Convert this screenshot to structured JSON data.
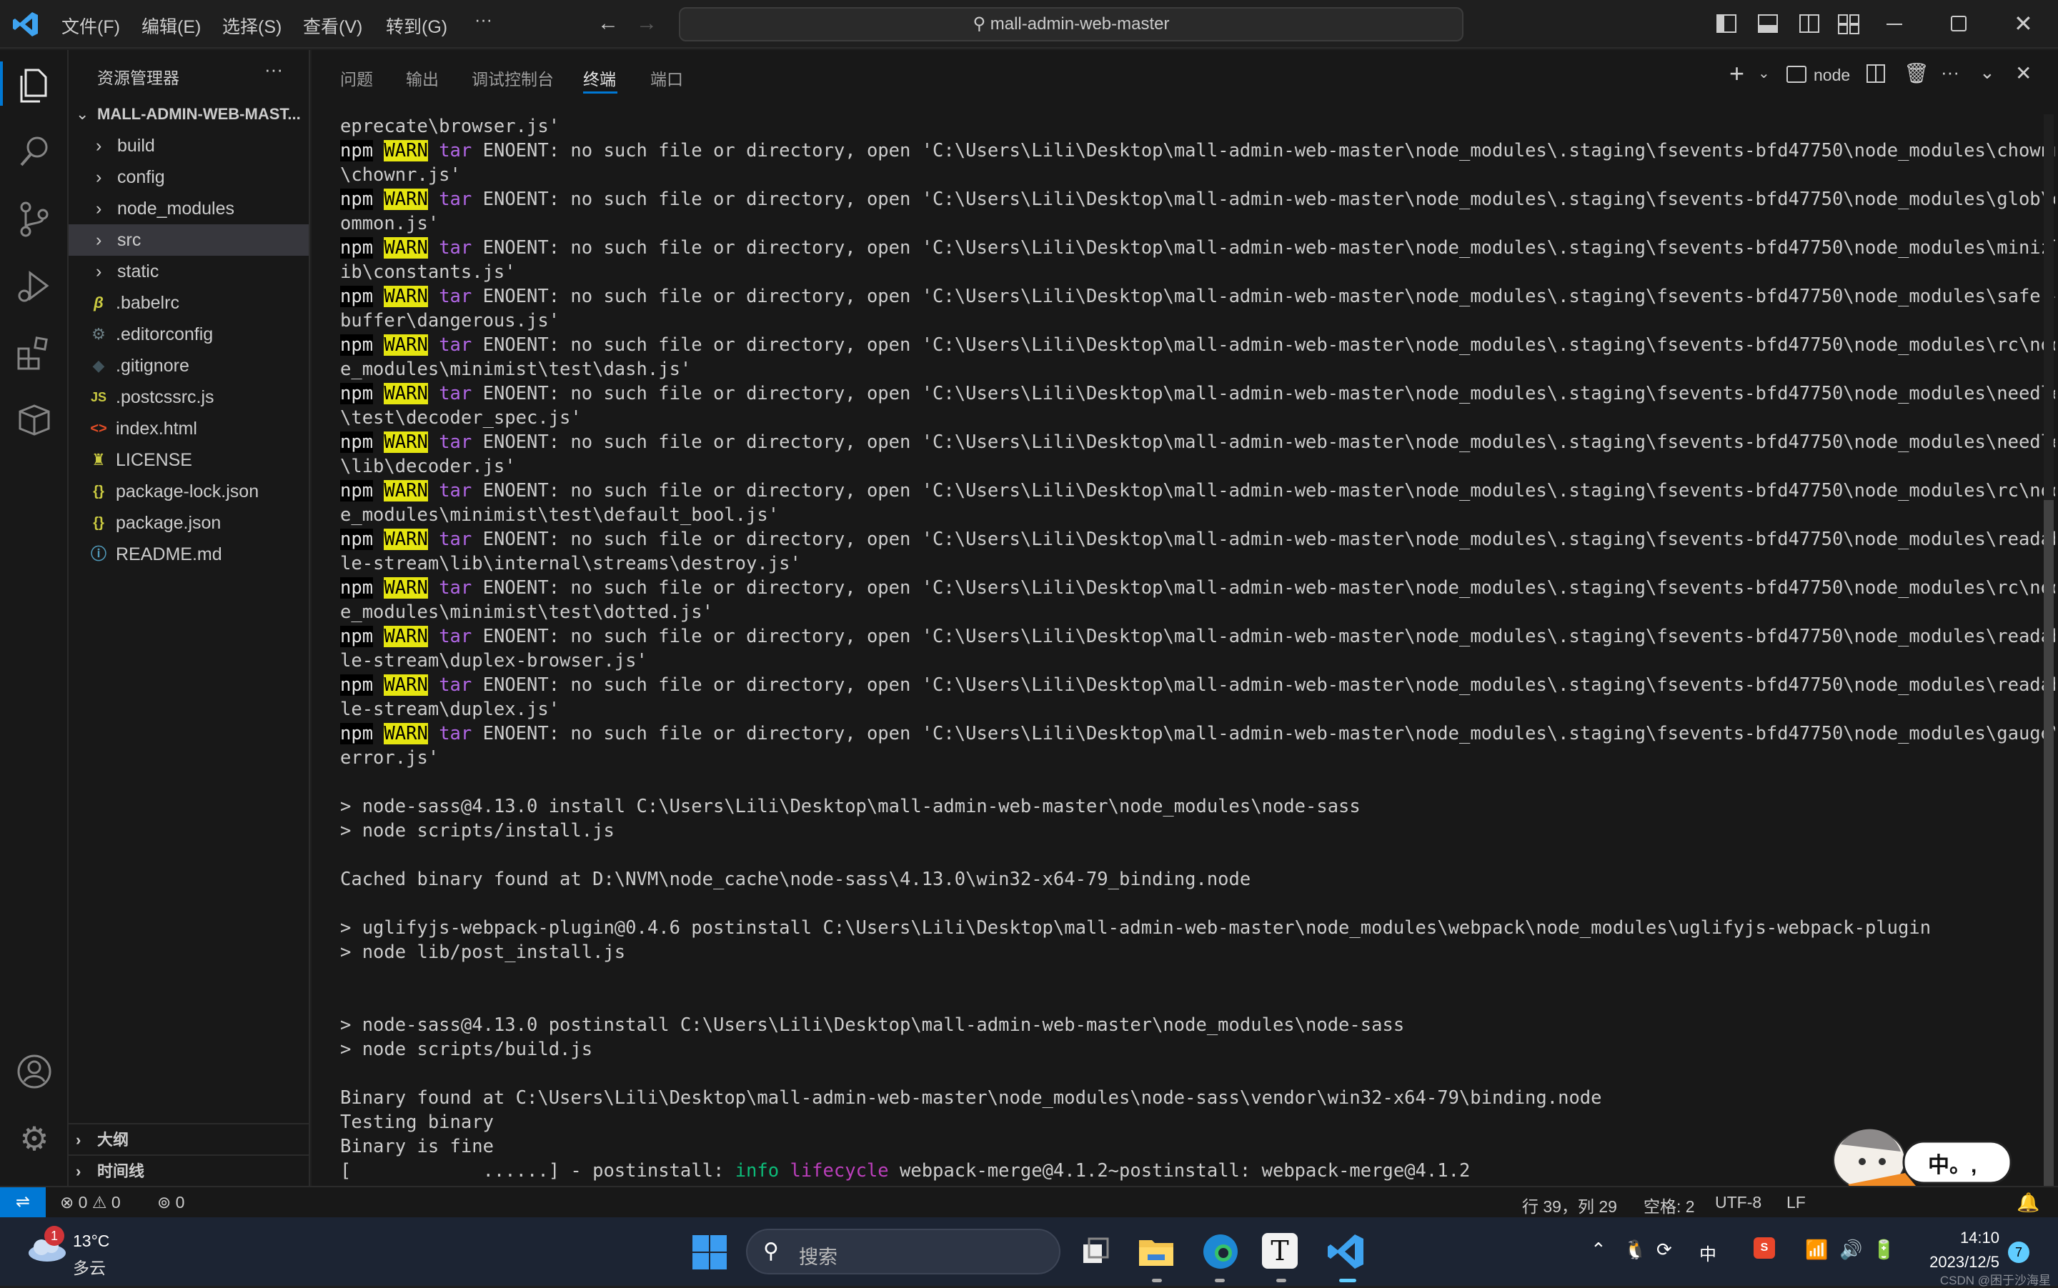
{
  "titlebar": {
    "menus": [
      "文件(F)",
      "编辑(E)",
      "选择(S)",
      "查看(V)",
      "转到(G)"
    ],
    "more": "···",
    "search_text": "mall-admin-web-master"
  },
  "sidebar": {
    "title": "资源管理器",
    "more": "···",
    "root": "MALL-ADMIN-WEB-MAST...",
    "folders": [
      "build",
      "config",
      "node_modules",
      "src",
      "static"
    ],
    "files": [
      {
        "name": ".babelrc",
        "icon": "B",
        "color": "#cbcb41"
      },
      {
        "name": ".editorconfig",
        "icon": "⚙",
        "color": "#6d8086"
      },
      {
        "name": ".gitignore",
        "icon": "◆",
        "color": "#41535b"
      },
      {
        "name": ".postcssrc.js",
        "icon": "JS",
        "color": "#cbcb41"
      },
      {
        "name": "index.html",
        "icon": "<>",
        "color": "#e44d26"
      },
      {
        "name": "LICENSE",
        "icon": "♜",
        "color": "#cbcb41"
      },
      {
        "name": "package-lock.json",
        "icon": "{}",
        "color": "#cbcb41"
      },
      {
        "name": "package.json",
        "icon": "{}",
        "color": "#cbcb41"
      },
      {
        "name": "README.md",
        "icon": "ⓘ",
        "color": "#519aba"
      }
    ],
    "outline": "大纲",
    "timeline": "时间线"
  },
  "panel": {
    "tabs": [
      "问题",
      "输出",
      "调试控制台",
      "终端",
      "端口"
    ],
    "active_tab": 3,
    "terminal_name": "node"
  },
  "terminal": {
    "prefix": "npm",
    "warn": "WARN",
    "tar": "tar",
    "lines": [
      {
        "t": "eprecate\\browser.js'"
      },
      {
        "w": " ENOENT: no such file or directory, open 'C:\\Users\\Lili\\Desktop\\mall-admin-web-master\\node_modules\\.staging\\fsevents-bfd47750\\node_modules\\chownr"
      },
      {
        "t": "\\chownr.js'"
      },
      {
        "w": " ENOENT: no such file or directory, open 'C:\\Users\\Lili\\Desktop\\mall-admin-web-master\\node_modules\\.staging\\fsevents-bfd47750\\node_modules\\glob\\c"
      },
      {
        "t": "ommon.js'"
      },
      {
        "w": " ENOENT: no such file or directory, open 'C:\\Users\\Lili\\Desktop\\mall-admin-web-master\\node_modules\\.staging\\fsevents-bfd47750\\node_modules\\minizl"
      },
      {
        "t": "ib\\constants.js'"
      },
      {
        "w": " ENOENT: no such file or directory, open 'C:\\Users\\Lili\\Desktop\\mall-admin-web-master\\node_modules\\.staging\\fsevents-bfd47750\\node_modules\\safer-"
      },
      {
        "t": "buffer\\dangerous.js'"
      },
      {
        "w": " ENOENT: no such file or directory, open 'C:\\Users\\Lili\\Desktop\\mall-admin-web-master\\node_modules\\.staging\\fsevents-bfd47750\\node_modules\\rc\\nod"
      },
      {
        "t": "e_modules\\minimist\\test\\dash.js'"
      },
      {
        "w": " ENOENT: no such file or directory, open 'C:\\Users\\Lili\\Desktop\\mall-admin-web-master\\node_modules\\.staging\\fsevents-bfd47750\\node_modules\\needle"
      },
      {
        "t": "\\test\\decoder_spec.js'"
      },
      {
        "w": " ENOENT: no such file or directory, open 'C:\\Users\\Lili\\Desktop\\mall-admin-web-master\\node_modules\\.staging\\fsevents-bfd47750\\node_modules\\needle"
      },
      {
        "t": "\\lib\\decoder.js'"
      },
      {
        "w": " ENOENT: no such file or directory, open 'C:\\Users\\Lili\\Desktop\\mall-admin-web-master\\node_modules\\.staging\\fsevents-bfd47750\\node_modules\\rc\\nod"
      },
      {
        "t": "e_modules\\minimist\\test\\default_bool.js'"
      },
      {
        "w": " ENOENT: no such file or directory, open 'C:\\Users\\Lili\\Desktop\\mall-admin-web-master\\node_modules\\.staging\\fsevents-bfd47750\\node_modules\\readab"
      },
      {
        "t": "le-stream\\lib\\internal\\streams\\destroy.js'"
      },
      {
        "w": " ENOENT: no such file or directory, open 'C:\\Users\\Lili\\Desktop\\mall-admin-web-master\\node_modules\\.staging\\fsevents-bfd47750\\node_modules\\rc\\nod"
      },
      {
        "t": "e_modules\\minimist\\test\\dotted.js'"
      },
      {
        "w": " ENOENT: no such file or directory, open 'C:\\Users\\Lili\\Desktop\\mall-admin-web-master\\node_modules\\.staging\\fsevents-bfd47750\\node_modules\\readab"
      },
      {
        "t": "le-stream\\duplex-browser.js'"
      },
      {
        "w": " ENOENT: no such file or directory, open 'C:\\Users\\Lili\\Desktop\\mall-admin-web-master\\node_modules\\.staging\\fsevents-bfd47750\\node_modules\\readab"
      },
      {
        "t": "le-stream\\duplex.js'"
      },
      {
        "w": " ENOENT: no such file or directory, open 'C:\\Users\\Lili\\Desktop\\mall-admin-web-master\\node_modules\\.staging\\fsevents-bfd47750\\node_modules\\gauge\\"
      },
      {
        "t": "error.js'"
      },
      {
        "t": ""
      },
      {
        "t": "> node-sass@4.13.0 install C:\\Users\\Lili\\Desktop\\mall-admin-web-master\\node_modules\\node-sass"
      },
      {
        "t": "> node scripts/install.js"
      },
      {
        "t": ""
      },
      {
        "t": "Cached binary found at D:\\NVM\\node_cache\\node-sass\\4.13.0\\win32-x64-79_binding.node"
      },
      {
        "t": ""
      },
      {
        "t": "> uglifyjs-webpack-plugin@0.4.6 postinstall C:\\Users\\Lili\\Desktop\\mall-admin-web-master\\node_modules\\webpack\\node_modules\\uglifyjs-webpack-plugin"
      },
      {
        "t": "> node lib/post_install.js"
      },
      {
        "t": ""
      },
      {
        "t": ""
      },
      {
        "t": "> node-sass@4.13.0 postinstall C:\\Users\\Lili\\Desktop\\mall-admin-web-master\\node_modules\\node-sass"
      },
      {
        "t": "> node scripts/build.js"
      },
      {
        "t": ""
      },
      {
        "t": "Binary found at C:\\Users\\Lili\\Desktop\\mall-admin-web-master\\node_modules\\node-sass\\vendor\\win32-x64-79\\binding.node"
      },
      {
        "t": "Testing binary"
      },
      {
        "t": "Binary is fine"
      }
    ],
    "last": {
      "start": "[            ......] - postinstall: ",
      "info": "info",
      "lifecycle": "lifecycle",
      "rest": " webpack-merge@4.1.2~postinstall: webpack-merge@4.1.2"
    }
  },
  "statusbar": {
    "errors": "0",
    "warnings": "0",
    "ports": "0",
    "position": "行 39，列 29",
    "spaces": "空格: 2",
    "encoding": "UTF-8",
    "eol": "LF"
  },
  "sticker": {
    "text": "中。,"
  },
  "taskbar": {
    "weather_temp": "13°C",
    "weather_desc": "多云",
    "weather_badge": "1",
    "search_placeholder": "搜索",
    "ime": "中",
    "time": "14:10",
    "date": "2023/12/5",
    "notif_count": "7",
    "watermark": "CSDN @困于沙海星"
  },
  "colors": {
    "accent": "#0078d4",
    "warn_bg": "#e5e510",
    "tar": "#b267e6",
    "info": "#0dbc79",
    "lifecycle": "#bc3fbc"
  }
}
